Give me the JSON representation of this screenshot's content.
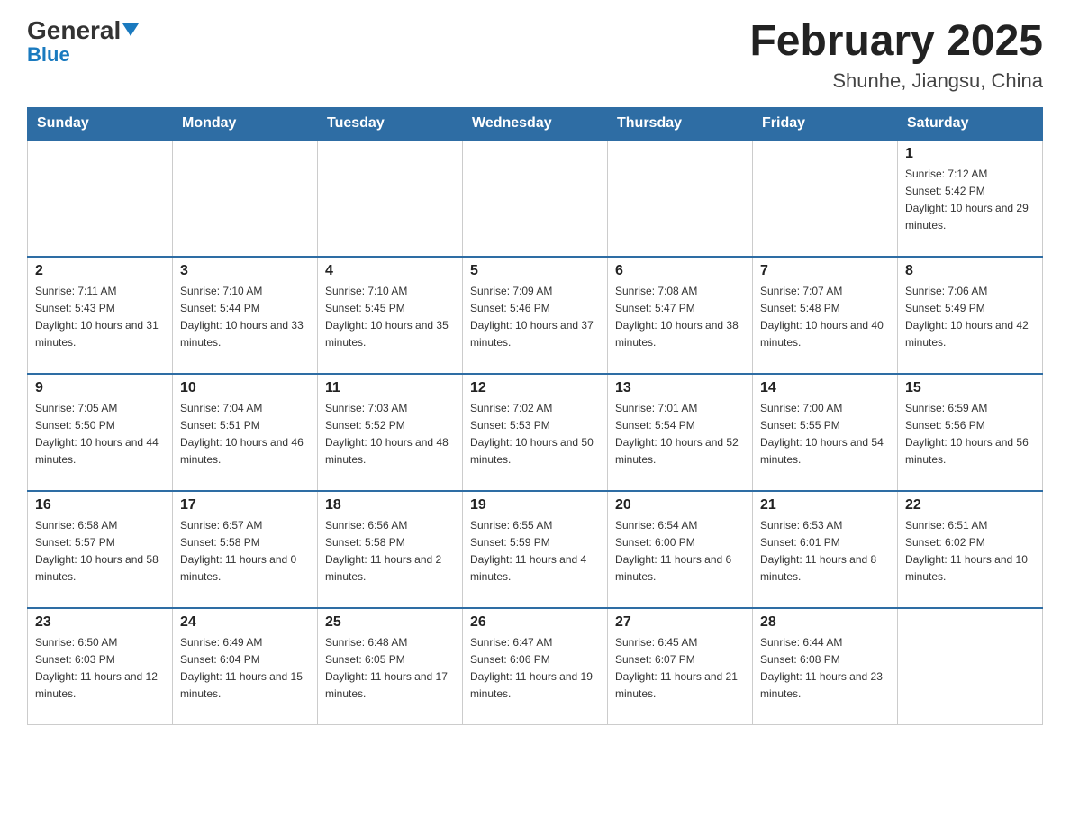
{
  "header": {
    "logo_general": "General",
    "logo_blue": "Blue",
    "title": "February 2025",
    "subtitle": "Shunhe, Jiangsu, China"
  },
  "days_of_week": [
    "Sunday",
    "Monday",
    "Tuesday",
    "Wednesday",
    "Thursday",
    "Friday",
    "Saturday"
  ],
  "weeks": [
    [
      {
        "day": "",
        "sunrise": "",
        "sunset": "",
        "daylight": ""
      },
      {
        "day": "",
        "sunrise": "",
        "sunset": "",
        "daylight": ""
      },
      {
        "day": "",
        "sunrise": "",
        "sunset": "",
        "daylight": ""
      },
      {
        "day": "",
        "sunrise": "",
        "sunset": "",
        "daylight": ""
      },
      {
        "day": "",
        "sunrise": "",
        "sunset": "",
        "daylight": ""
      },
      {
        "day": "",
        "sunrise": "",
        "sunset": "",
        "daylight": ""
      },
      {
        "day": "1",
        "sunrise": "Sunrise: 7:12 AM",
        "sunset": "Sunset: 5:42 PM",
        "daylight": "Daylight: 10 hours and 29 minutes."
      }
    ],
    [
      {
        "day": "2",
        "sunrise": "Sunrise: 7:11 AM",
        "sunset": "Sunset: 5:43 PM",
        "daylight": "Daylight: 10 hours and 31 minutes."
      },
      {
        "day": "3",
        "sunrise": "Sunrise: 7:10 AM",
        "sunset": "Sunset: 5:44 PM",
        "daylight": "Daylight: 10 hours and 33 minutes."
      },
      {
        "day": "4",
        "sunrise": "Sunrise: 7:10 AM",
        "sunset": "Sunset: 5:45 PM",
        "daylight": "Daylight: 10 hours and 35 minutes."
      },
      {
        "day": "5",
        "sunrise": "Sunrise: 7:09 AM",
        "sunset": "Sunset: 5:46 PM",
        "daylight": "Daylight: 10 hours and 37 minutes."
      },
      {
        "day": "6",
        "sunrise": "Sunrise: 7:08 AM",
        "sunset": "Sunset: 5:47 PM",
        "daylight": "Daylight: 10 hours and 38 minutes."
      },
      {
        "day": "7",
        "sunrise": "Sunrise: 7:07 AM",
        "sunset": "Sunset: 5:48 PM",
        "daylight": "Daylight: 10 hours and 40 minutes."
      },
      {
        "day": "8",
        "sunrise": "Sunrise: 7:06 AM",
        "sunset": "Sunset: 5:49 PM",
        "daylight": "Daylight: 10 hours and 42 minutes."
      }
    ],
    [
      {
        "day": "9",
        "sunrise": "Sunrise: 7:05 AM",
        "sunset": "Sunset: 5:50 PM",
        "daylight": "Daylight: 10 hours and 44 minutes."
      },
      {
        "day": "10",
        "sunrise": "Sunrise: 7:04 AM",
        "sunset": "Sunset: 5:51 PM",
        "daylight": "Daylight: 10 hours and 46 minutes."
      },
      {
        "day": "11",
        "sunrise": "Sunrise: 7:03 AM",
        "sunset": "Sunset: 5:52 PM",
        "daylight": "Daylight: 10 hours and 48 minutes."
      },
      {
        "day": "12",
        "sunrise": "Sunrise: 7:02 AM",
        "sunset": "Sunset: 5:53 PM",
        "daylight": "Daylight: 10 hours and 50 minutes."
      },
      {
        "day": "13",
        "sunrise": "Sunrise: 7:01 AM",
        "sunset": "Sunset: 5:54 PM",
        "daylight": "Daylight: 10 hours and 52 minutes."
      },
      {
        "day": "14",
        "sunrise": "Sunrise: 7:00 AM",
        "sunset": "Sunset: 5:55 PM",
        "daylight": "Daylight: 10 hours and 54 minutes."
      },
      {
        "day": "15",
        "sunrise": "Sunrise: 6:59 AM",
        "sunset": "Sunset: 5:56 PM",
        "daylight": "Daylight: 10 hours and 56 minutes."
      }
    ],
    [
      {
        "day": "16",
        "sunrise": "Sunrise: 6:58 AM",
        "sunset": "Sunset: 5:57 PM",
        "daylight": "Daylight: 10 hours and 58 minutes."
      },
      {
        "day": "17",
        "sunrise": "Sunrise: 6:57 AM",
        "sunset": "Sunset: 5:58 PM",
        "daylight": "Daylight: 11 hours and 0 minutes."
      },
      {
        "day": "18",
        "sunrise": "Sunrise: 6:56 AM",
        "sunset": "Sunset: 5:58 PM",
        "daylight": "Daylight: 11 hours and 2 minutes."
      },
      {
        "day": "19",
        "sunrise": "Sunrise: 6:55 AM",
        "sunset": "Sunset: 5:59 PM",
        "daylight": "Daylight: 11 hours and 4 minutes."
      },
      {
        "day": "20",
        "sunrise": "Sunrise: 6:54 AM",
        "sunset": "Sunset: 6:00 PM",
        "daylight": "Daylight: 11 hours and 6 minutes."
      },
      {
        "day": "21",
        "sunrise": "Sunrise: 6:53 AM",
        "sunset": "Sunset: 6:01 PM",
        "daylight": "Daylight: 11 hours and 8 minutes."
      },
      {
        "day": "22",
        "sunrise": "Sunrise: 6:51 AM",
        "sunset": "Sunset: 6:02 PM",
        "daylight": "Daylight: 11 hours and 10 minutes."
      }
    ],
    [
      {
        "day": "23",
        "sunrise": "Sunrise: 6:50 AM",
        "sunset": "Sunset: 6:03 PM",
        "daylight": "Daylight: 11 hours and 12 minutes."
      },
      {
        "day": "24",
        "sunrise": "Sunrise: 6:49 AM",
        "sunset": "Sunset: 6:04 PM",
        "daylight": "Daylight: 11 hours and 15 minutes."
      },
      {
        "day": "25",
        "sunrise": "Sunrise: 6:48 AM",
        "sunset": "Sunset: 6:05 PM",
        "daylight": "Daylight: 11 hours and 17 minutes."
      },
      {
        "day": "26",
        "sunrise": "Sunrise: 6:47 AM",
        "sunset": "Sunset: 6:06 PM",
        "daylight": "Daylight: 11 hours and 19 minutes."
      },
      {
        "day": "27",
        "sunrise": "Sunrise: 6:45 AM",
        "sunset": "Sunset: 6:07 PM",
        "daylight": "Daylight: 11 hours and 21 minutes."
      },
      {
        "day": "28",
        "sunrise": "Sunrise: 6:44 AM",
        "sunset": "Sunset: 6:08 PM",
        "daylight": "Daylight: 11 hours and 23 minutes."
      },
      {
        "day": "",
        "sunrise": "",
        "sunset": "",
        "daylight": ""
      }
    ]
  ]
}
